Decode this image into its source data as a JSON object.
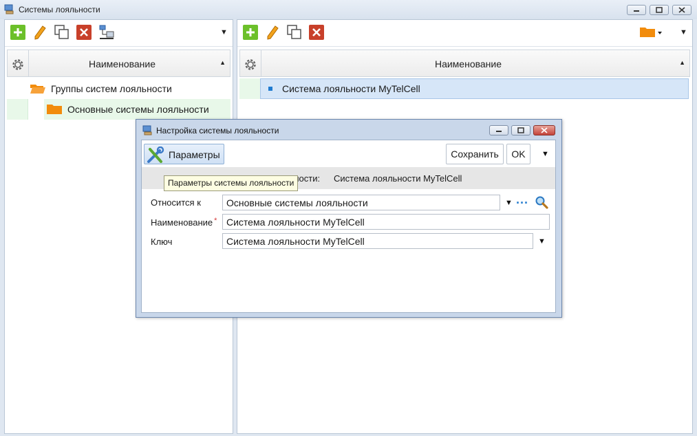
{
  "window": {
    "title": "Системы лояльности"
  },
  "left_panel": {
    "column_header": "Наименование",
    "tree": [
      {
        "label": "Группы систем лояльности",
        "level": 0
      },
      {
        "label": "Основные системы лояльности",
        "level": 1
      }
    ]
  },
  "right_panel": {
    "column_header": "Наименование",
    "rows": [
      {
        "label": "Система лояльности MyTelCell"
      }
    ]
  },
  "dialog": {
    "title": "Настройка системы лояльности",
    "params_button": "Параметры",
    "save_button": "Сохранить",
    "ok_button": "OK",
    "tooltip": "Параметры системы лояльности",
    "info_label_visible": "льности:",
    "info_value": "Система лояльности MyTelCell",
    "fields": {
      "belongs_to_label": "Относится к",
      "belongs_to_value": "Основные системы лояльности",
      "name_label": "Наименование",
      "name_required_mark": "*",
      "name_value": "Система лояльности MyTelCell",
      "key_label": "Ключ",
      "key_value": "Система лояльности MyTelCell",
      "browse_dots": "..."
    }
  },
  "colors": {
    "add_green": "#6cc02a",
    "delete_red": "#c8402a",
    "folder_orange": "#f28c0c",
    "selection_blue": "#d6e6f8",
    "selection_green": "#e8f8e9"
  }
}
